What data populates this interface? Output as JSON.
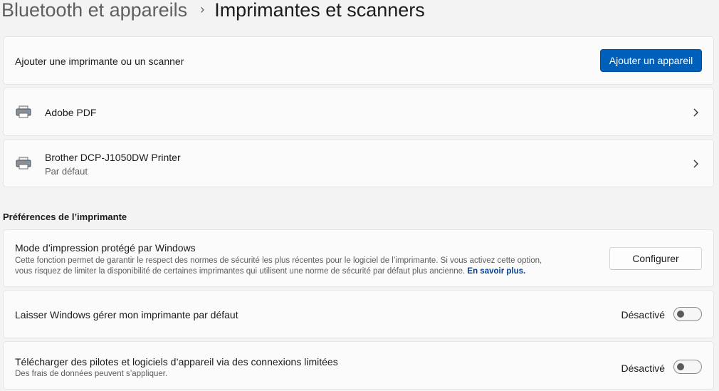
{
  "breadcrumb": {
    "parent": "Bluetooth et appareils",
    "separator": "›",
    "current": "Imprimantes et scanners"
  },
  "add_device": {
    "label": "Ajouter une imprimante ou un scanner",
    "button": "Ajouter un appareil"
  },
  "printers": [
    {
      "name": "Adobe PDF",
      "subtitle": "",
      "icon": "printer-icon"
    },
    {
      "name": "Brother DCP-J1050DW Printer",
      "subtitle": "Par défaut",
      "icon": "printer-icon"
    }
  ],
  "preferences": {
    "section_title": "Préférences de l’imprimante",
    "protected_mode": {
      "title": "Mode d’impression protégé par Windows",
      "description_line1": "Cette fonction permet de garantir le respect des normes de sécurité les plus récentes pour le logiciel de l’imprimante. Si vous activez cette option,",
      "description_line2": "vous risquez de limiter la disponibilité de certaines imprimantes qui utilisent une norme de sécurité par défaut plus ancienne.",
      "link": "En savoir plus.",
      "button": "Configurer"
    },
    "default_printer": {
      "title": "Laisser Windows gérer mon imprimante par défaut",
      "state_label": "Désactivé",
      "on": false
    },
    "metered_download": {
      "title": "Télécharger des pilotes et logiciels d’appareil via des connexions limitées",
      "subtitle": "Des frais de données peuvent s’appliquer.",
      "state_label": "Désactivé",
      "on": false
    }
  },
  "colors": {
    "accent": "#005fb8",
    "background": "#f3f3f3",
    "card": "#fbfbfb"
  }
}
